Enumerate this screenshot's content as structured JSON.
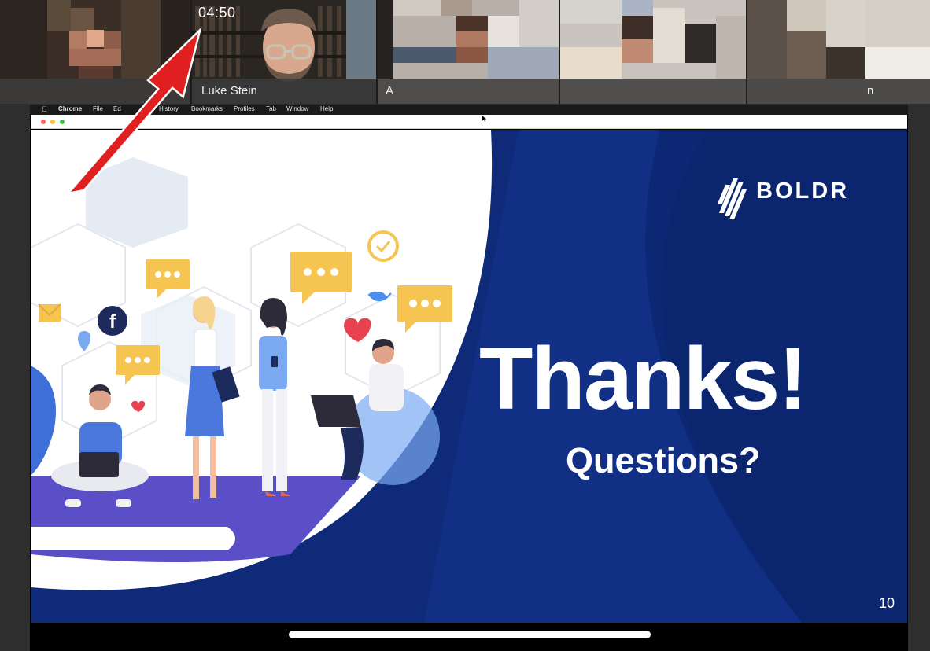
{
  "call": {
    "timer": "04:50",
    "participants": [
      {
        "name": ""
      },
      {
        "name": "Luke Stein"
      },
      {
        "name": "A"
      },
      {
        "name": ""
      },
      {
        "name": "n"
      }
    ]
  },
  "menubar": {
    "items": [
      "Chrome",
      "File",
      "Ed",
      "History",
      "Bookmarks",
      "Profiles",
      "Tab",
      "Window",
      "Help"
    ]
  },
  "slide": {
    "logo": "BOLDR",
    "headline": "Thanks!",
    "subheadline": "Questions?",
    "page_number": "10"
  },
  "icons": [
    "apple-icon",
    "facebook-icon",
    "twitter-icon",
    "heart-icon",
    "location-pin-icon",
    "checkmark-icon",
    "chat-bubble-icon",
    "laptop-icon",
    "boldr-logo-icon"
  ],
  "colors": {
    "slide_navy": "#0e2a78",
    "slide_navy_dark": "#0a2060",
    "accent_yellow": "#f6c451",
    "accent_purple": "#5b4fc8",
    "arrow_red": "#e02020"
  }
}
